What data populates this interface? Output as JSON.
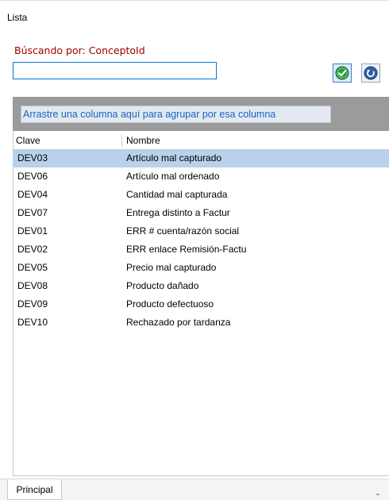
{
  "window": {
    "title": "Lista"
  },
  "search": {
    "label": "Búscando por: ConceptoId",
    "value": ""
  },
  "buttons": {
    "accept_icon": "check-circle-icon",
    "back_icon": "undo-arrow-icon"
  },
  "grid": {
    "group_hint": "Arrastre una columna aquí para agrupar por esa columna",
    "columns": [
      "Clave",
      "Nombre"
    ],
    "rows": [
      {
        "clave": "DEV03",
        "nombre": "Artículo mal capturado"
      },
      {
        "clave": "DEV06",
        "nombre": "Artículo mal ordenado"
      },
      {
        "clave": "DEV04",
        "nombre": "Cantidad mal capturada"
      },
      {
        "clave": "DEV07",
        "nombre": "Entrega distinto a Factur"
      },
      {
        "clave": "DEV01",
        "nombre": "ERR # cuenta/razón social"
      },
      {
        "clave": "DEV02",
        "nombre": "ERR enlace Remisión-Factu"
      },
      {
        "clave": "DEV05",
        "nombre": "Precio mal capturado"
      },
      {
        "clave": "DEV08",
        "nombre": "Producto dañado"
      },
      {
        "clave": "DEV09",
        "nombre": "Producto defectuoso"
      },
      {
        "clave": "DEV10",
        "nombre": "Rechazado por tardanza"
      }
    ],
    "selected_index": 0
  },
  "tabs": [
    {
      "label": "Principal"
    }
  ],
  "colors": {
    "accent": "#0078d7",
    "label_red": "#a00000",
    "selection": "#b9d1ea",
    "group_band": "#9b9b9b",
    "link_blue": "#1565c0"
  }
}
